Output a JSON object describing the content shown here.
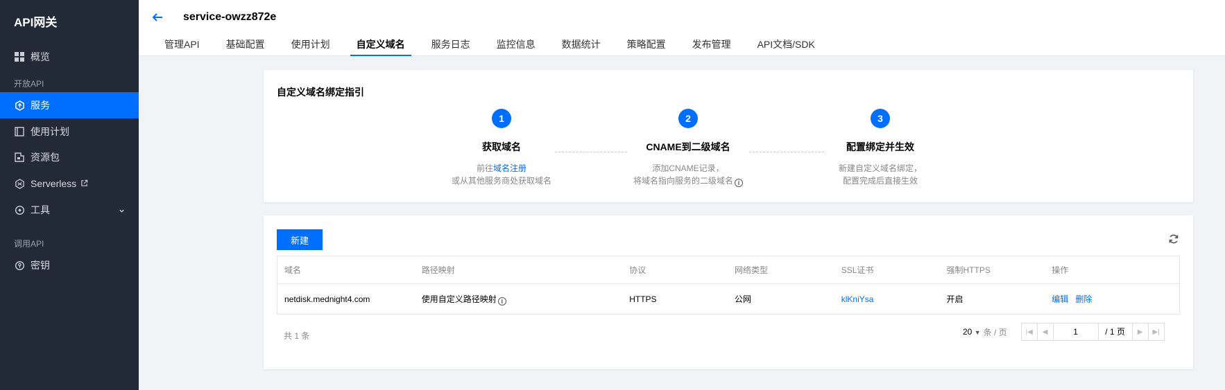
{
  "sidebar": {
    "brand": "API网关",
    "items": [
      {
        "label": "概览"
      },
      {
        "label": "服务"
      },
      {
        "label": "使用计划"
      },
      {
        "label": "资源包"
      },
      {
        "label": "Serverless"
      },
      {
        "label": "工具"
      },
      {
        "label": "密钥"
      }
    ],
    "groups": [
      "开放API",
      "调用API"
    ]
  },
  "header": {
    "title": "service-owzz872e",
    "tabs": [
      "管理API",
      "基础配置",
      "使用计划",
      "自定义域名",
      "服务日志",
      "监控信息",
      "数据统计",
      "策略配置",
      "发布管理",
      "API文档/SDK"
    ],
    "active_tab": "自定义域名"
  },
  "guide": {
    "title": "自定义域名绑定指引",
    "steps": [
      {
        "num": "1",
        "title": "获取域名",
        "desc1_prefix": "前往",
        "desc1_link": "域名注册",
        "desc2": "或从其他服务商处获取域名"
      },
      {
        "num": "2",
        "title": "CNAME到二级域名",
        "desc1": "添加CNAME记录，",
        "desc2": "将域名指向服务的二级域名"
      },
      {
        "num": "3",
        "title": "配置绑定并生效",
        "desc1": "新建自定义域名绑定，",
        "desc2": "配置完成后直接生效"
      }
    ]
  },
  "table": {
    "new_button": "新建",
    "columns": [
      "域名",
      "路径映射",
      "协议",
      "网络类型",
      "SSL证书",
      "强制HTTPS",
      "操作"
    ],
    "rows": [
      {
        "domain": "netdisk.mednight4.com",
        "path_mapping": "使用自定义路径映射",
        "protocol": "HTTPS",
        "network": "公网",
        "ssl": "klKniYsa",
        "force_https": "开启",
        "edit": "编辑",
        "delete": "删除"
      }
    ],
    "total": "共 1 条",
    "page_size": "20",
    "page_size_unit": "条 / 页",
    "page_current": "1",
    "page_total": "/ 1 页"
  },
  "colors": {
    "accent": "#006eff",
    "sidebar_bg": "#232a37"
  }
}
